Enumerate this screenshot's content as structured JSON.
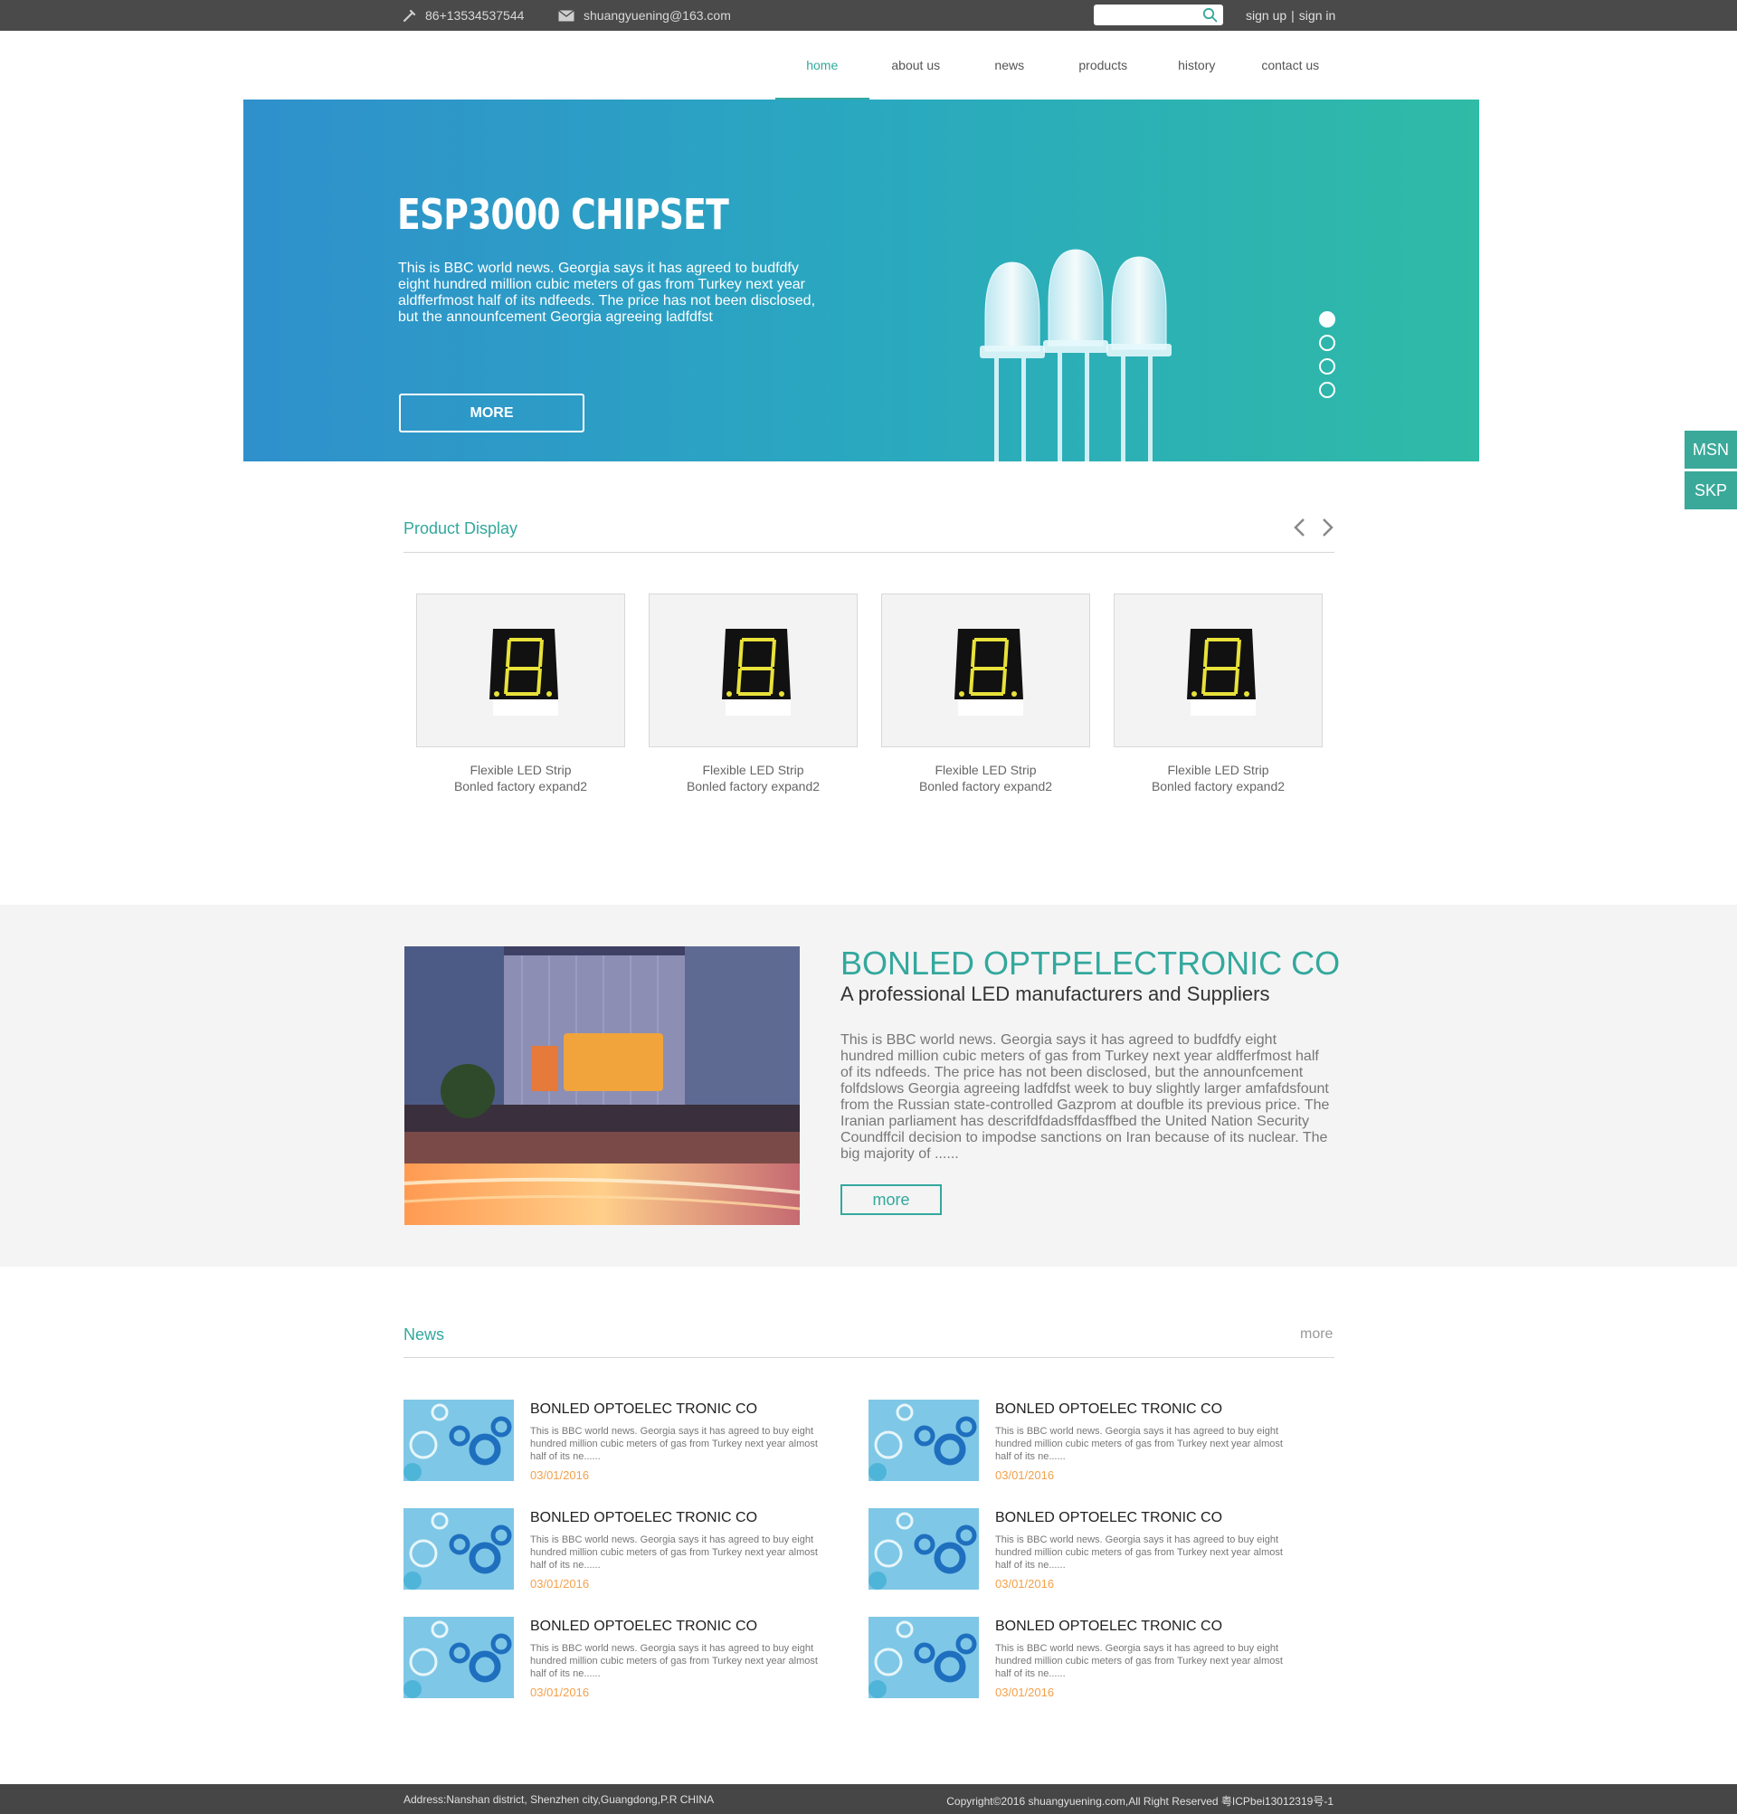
{
  "topbar": {
    "phone": "86+13534537544",
    "email": "shuangyuening@163.com",
    "search_placeholder": "",
    "sign_up": "sign up",
    "separator": "|",
    "sign_in": "sign in"
  },
  "nav": {
    "items": [
      {
        "label": "home"
      },
      {
        "label": "about us"
      },
      {
        "label": "news"
      },
      {
        "label": "products"
      },
      {
        "label": "history"
      },
      {
        "label": "contact us"
      }
    ],
    "active": "home"
  },
  "banner": {
    "title": "ESP3000 CHIPSET",
    "text": "This is BBC world news. Georgia says it has agreed to budfdfy eight hundred million cubic meters of gas from Turkey next year aldfferfmost half of its ndfeeds. The price has not been disclosed, but the announfcement Georgia agreeing ladfdfst",
    "button": "MORE",
    "slides": 4,
    "active_slide": 1
  },
  "side": {
    "msn": "MSN",
    "skp": "SKP"
  },
  "products": {
    "title": "Product Display",
    "items": [
      {
        "line1": "Flexible LED Strip",
        "line2": "Bonled factory expand2"
      },
      {
        "line1": "Flexible LED Strip",
        "line2": "Bonled factory expand2"
      },
      {
        "line1": "Flexible LED Strip",
        "line2": "Bonled factory expand2"
      },
      {
        "line1": "Flexible LED Strip",
        "line2": "Bonled factory expand2"
      }
    ]
  },
  "about": {
    "title": "BONLED OPTPELECTRONIC CO",
    "subtitle": "A professional LED manufacturers and Suppliers",
    "text": "This is BBC world news. Georgia says it has agreed to budfdfy eight hundred million cubic meters of gas from Turkey next year aldfferfmost half of its ndfeeds. The price has not been disclosed, but the announfcement folfdslows Georgia agreeing ladfdfst week to buy slightly larger amfafdsfount from the Russian state-controlled Gazprom at doufble its previous price. The Iranian parliament has descrifdfdadsffdasffbed the United Nation Security Coundffcil decision to impodse sanctions on Iran because of its nuclear. The big majority of ......",
    "button": "more"
  },
  "news": {
    "title": "News",
    "more": "more",
    "items": [
      {
        "title": "BONLED OPTOELEC TRONIC CO",
        "text": "This is BBC world news. Georgia says it has agreed to buy eight hundred million cubic meters of gas from Turkey next year almost half of its ne......",
        "date": "03/01/2016"
      },
      {
        "title": "BONLED OPTOELEC TRONIC CO",
        "text": "This is BBC world news. Georgia says it has agreed to buy eight hundred million cubic meters of gas from Turkey next year almost half of its ne......",
        "date": "03/01/2016"
      },
      {
        "title": "BONLED OPTOELEC TRONIC CO",
        "text": "This is BBC world news. Georgia says it has agreed to buy eight hundred million cubic meters of gas from Turkey next year almost half of its ne......",
        "date": "03/01/2016"
      },
      {
        "title": "BONLED OPTOELEC TRONIC CO",
        "text": "This is BBC world news. Georgia says it has agreed to buy eight hundred million cubic meters of gas from Turkey next year almost half of its ne......",
        "date": "03/01/2016"
      },
      {
        "title": "BONLED OPTOELEC TRONIC CO",
        "text": "This is BBC world news. Georgia says it has agreed to buy eight hundred million cubic meters of gas from Turkey next year almost half of its ne......",
        "date": "03/01/2016"
      },
      {
        "title": "BONLED OPTOELEC TRONIC CO",
        "text": "This is BBC world news. Georgia says it has agreed to buy eight hundred million cubic meters of gas from Turkey next year almost half of its ne......",
        "date": "03/01/2016"
      }
    ]
  },
  "footer": {
    "address": "Address:Nanshan district, Shenzhen city,Guangdong,P.R CHINA",
    "copyright": "Copyright©2016 shuangyuening.com,All Right Reserved 粤ICPbei13012319号-1"
  },
  "colors": {
    "accent": "#33a89d",
    "banner_left": "#2f90cc",
    "banner_right": "#2fbba6",
    "topbar": "#4a4a4a",
    "date": "#f3a04a"
  },
  "icons": [
    "phone-icon",
    "mail-icon",
    "search-icon",
    "chevron-left-icon",
    "chevron-right-icon"
  ]
}
